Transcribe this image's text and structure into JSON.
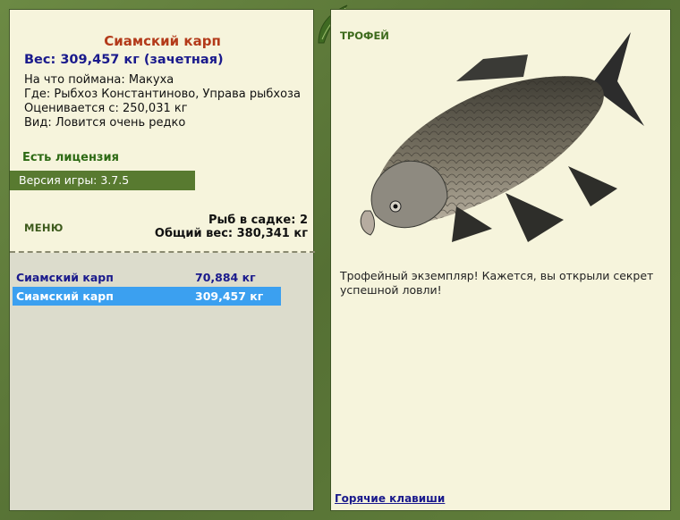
{
  "fish": {
    "name": "Сиамский карп",
    "weight_line": "Вес: 309,457 кг (зачетная)",
    "bait": "На что поймана: Макуха",
    "location": "Где: Рыбхоз Константиново, Управа рыбхоза",
    "valued": "Оценивается с: 250,031 кг",
    "rarity": "Вид: Ловится очень редко"
  },
  "license": "Есть лицензия",
  "version": "Версия игры: 3.7.5",
  "menu_label": "МЕНЮ",
  "net": {
    "count": "Рыб в садке: 2",
    "total": "Общий вес: 380,341 кг"
  },
  "catch_list": [
    {
      "name": "Сиамский карп",
      "weight": "70,884 кг",
      "selected": false
    },
    {
      "name": "Сиамский карп",
      "weight": "309,457 кг",
      "selected": true
    }
  ],
  "trophy": {
    "label": "ТРОФЕЙ",
    "text": "Трофейный экземпляр! Кажется, вы открыли секрет успешной ловли!"
  },
  "hotkeys": "Горячие клавиши",
  "colors": {
    "frame": "#5e7a3a",
    "panel": "#f6f4dc",
    "title": "#b33a1a",
    "accent_blue": "#1a1a8c",
    "selection": "#3ba0f0"
  }
}
